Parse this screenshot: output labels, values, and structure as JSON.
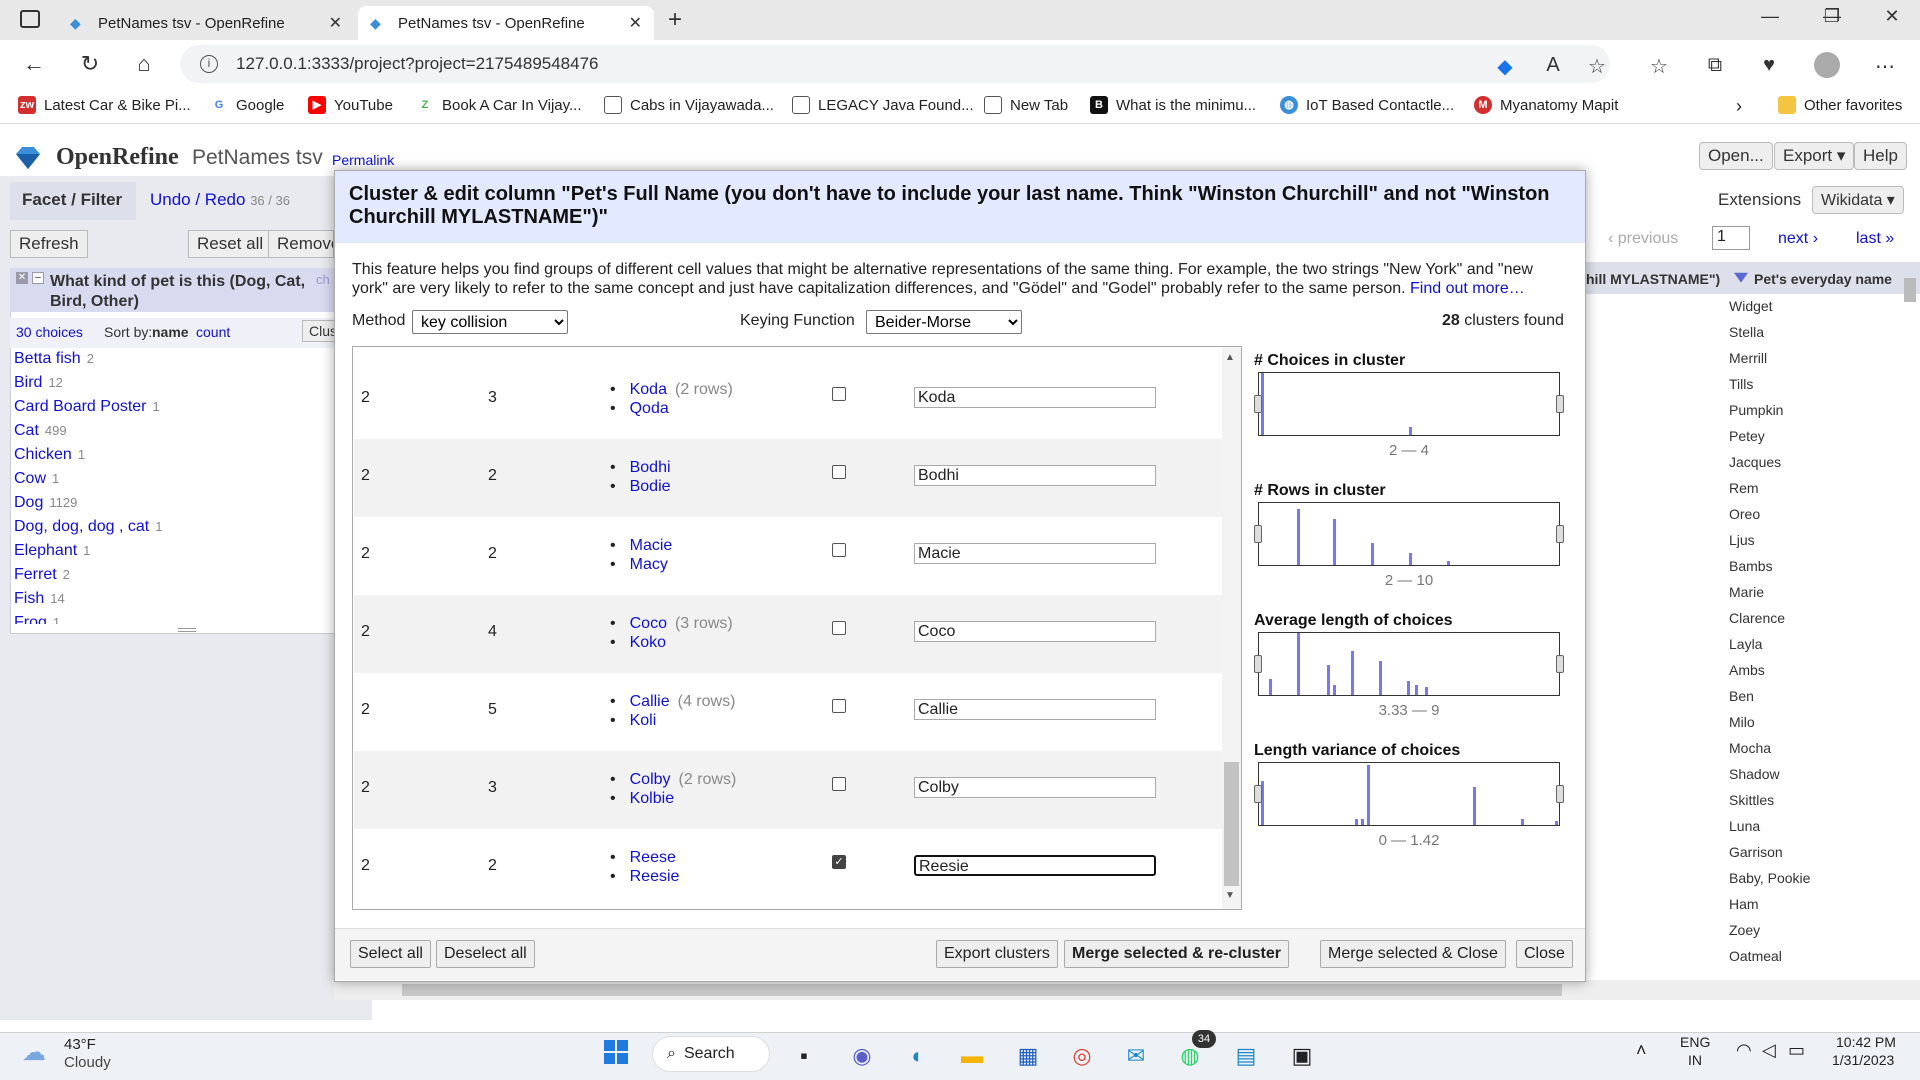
{
  "browser": {
    "tabs": [
      {
        "title": "PetNames tsv - OpenRefine"
      },
      {
        "title": "PetNames tsv - OpenRefine"
      }
    ],
    "url": "127.0.0.1:3333/project?project=2175489548476",
    "bookmarks": [
      {
        "label": "Latest Car & Bike Pi...",
        "icon": "zw-icon",
        "color": "#d32f2f"
      },
      {
        "label": "Google",
        "icon": "google-icon",
        "color": "#4285f4"
      },
      {
        "label": "YouTube",
        "icon": "youtube-icon",
        "color": "#ff0000"
      },
      {
        "label": "Book A Car In Vijay...",
        "icon": "zoomcar-icon",
        "color": "#4caf50"
      },
      {
        "label": "Cabs in Vijayawada...",
        "icon": "page-icon",
        "color": "#888888"
      },
      {
        "label": "LEGACY Java Found...",
        "icon": "page-icon",
        "color": "#888888"
      },
      {
        "label": "New Tab",
        "icon": "page-icon",
        "color": "#888888"
      },
      {
        "label": "What is the minimu...",
        "icon": "b-icon",
        "color": "#111111"
      },
      {
        "label": "IoT Based Contactle...",
        "icon": "globe-icon",
        "color": "#3b8fd9"
      },
      {
        "label": "Myanatomy Mapit",
        "icon": "ma-icon",
        "color": "#d32f2f"
      }
    ],
    "other_favorites": "Other favorites"
  },
  "openrefine": {
    "app_name": "OpenRefine",
    "project_name": "PetNames tsv",
    "permalink": "Permalink",
    "header_buttons": [
      "Open...",
      "Export ▾",
      "Help"
    ],
    "extensions_label": "Extensions",
    "wikidata_button": "Wikidata ▾",
    "tab_facet": "Facet / Filter",
    "tab_undo": "Undo / Redo",
    "undo_count": "36 / 36",
    "refresh": "Refresh",
    "reset_all": "Reset all",
    "remove": "Remove",
    "facet": {
      "title": "What kind of pet is this (Dog, Cat, Bird, Other)",
      "change": "ch",
      "choices": "30 choices",
      "sort_by": "Sort by:",
      "sort_name": "name",
      "sort_count": "count",
      "cluster": "Clus",
      "items": [
        {
          "name": "Betta fish",
          "count": "2"
        },
        {
          "name": "Bird",
          "count": "12"
        },
        {
          "name": "Card Board Poster",
          "count": "1"
        },
        {
          "name": "Cat",
          "count": "499"
        },
        {
          "name": "Chicken",
          "count": "1"
        },
        {
          "name": "Cow",
          "count": "1"
        },
        {
          "name": "Dog",
          "count": "1129"
        },
        {
          "name": "Dog, dog, dog , cat",
          "count": "1"
        },
        {
          "name": "Elephant",
          "count": "1"
        },
        {
          "name": "Ferret",
          "count": "2"
        },
        {
          "name": "Fish",
          "count": "14"
        },
        {
          "name": "Frog",
          "count": "1"
        }
      ]
    },
    "grid": {
      "prev": "‹ previous",
      "page": "1",
      "next": "next ›",
      "last": "last »",
      "col_partial": "hill MYLASTNAME\")",
      "col_header": "Pet's everyday name",
      "rows": [
        "Widget",
        "Stella",
        "Merrill",
        "Tills",
        "Pumpkin",
        "Petey",
        "Jacques",
        "Rem",
        "Oreo",
        "Ljus",
        "Bambs",
        "Marie",
        "Clarence",
        "Layla",
        "Ambs",
        "Ben",
        "Milo",
        "Mocha",
        "Shadow",
        "Skittles",
        "Luna",
        "Garrison",
        "Baby, Pookie",
        "Ham",
        "Zoey",
        "Oatmeal"
      ]
    }
  },
  "dialog": {
    "title": "Cluster & edit column \"Pet's Full Name (you don't have to include your last name. Think \"Winston Churchill\" and not \"Winston Churchill MYLASTNAME\")\"",
    "description": "This feature helps you find groups of different cell values that might be alternative representations of the same thing. For example, the two strings \"New York\" and \"new york\" are very likely to refer to the same concept and just have capitalization differences, and \"Gödel\" and \"Godel\" probably refer to the same person.",
    "find_out_more": "Find out more…",
    "method_label": "Method",
    "method_value": "key collision",
    "keying_label": "Keying Function",
    "keying_value": "Beider-Morse",
    "clusters_count": "28",
    "clusters_found": "clusters found",
    "clusters": [
      {
        "size": "2",
        "rows": "3",
        "values": [
          {
            "v": "Koda",
            "rows": "(2 rows)"
          },
          {
            "v": "Qoda",
            "rows": ""
          }
        ],
        "checked": false,
        "new_value": "Koda"
      },
      {
        "size": "2",
        "rows": "2",
        "values": [
          {
            "v": "Bodhi",
            "rows": ""
          },
          {
            "v": "Bodie",
            "rows": ""
          }
        ],
        "checked": false,
        "new_value": "Bodhi"
      },
      {
        "size": "2",
        "rows": "2",
        "values": [
          {
            "v": "Macie",
            "rows": ""
          },
          {
            "v": "Macy",
            "rows": ""
          }
        ],
        "checked": false,
        "new_value": "Macie"
      },
      {
        "size": "2",
        "rows": "4",
        "values": [
          {
            "v": "Coco",
            "rows": "(3 rows)"
          },
          {
            "v": "Koko",
            "rows": ""
          }
        ],
        "checked": false,
        "new_value": "Coco"
      },
      {
        "size": "2",
        "rows": "5",
        "values": [
          {
            "v": "Callie",
            "rows": "(4 rows)"
          },
          {
            "v": "Koli",
            "rows": ""
          }
        ],
        "checked": false,
        "new_value": "Callie"
      },
      {
        "size": "2",
        "rows": "3",
        "values": [
          {
            "v": "Colby",
            "rows": "(2 rows)"
          },
          {
            "v": "Kolbie",
            "rows": ""
          }
        ],
        "checked": false,
        "new_value": "Colby"
      },
      {
        "size": "2",
        "rows": "2",
        "values": [
          {
            "v": "Reese",
            "rows": ""
          },
          {
            "v": "Reesie",
            "rows": ""
          }
        ],
        "checked": true,
        "new_value": "Reesie"
      }
    ],
    "histograms": [
      {
        "title": "# Choices in cluster",
        "range": "2 — 4"
      },
      {
        "title": "# Rows in cluster",
        "range": "2 — 10"
      },
      {
        "title": "Average length of choices",
        "range": "3.33 — 9"
      },
      {
        "title": "Length variance of choices",
        "range": "0 — 1.42"
      }
    ],
    "buttons": {
      "select_all": "Select all",
      "deselect_all": "Deselect all",
      "export": "Export clusters",
      "merge_recluster": "Merge selected & re-cluster",
      "merge_close": "Merge selected & Close",
      "close": "Close"
    }
  },
  "taskbar": {
    "temperature": "43°F",
    "weather": "Cloudy",
    "search": "Search",
    "whatsapp_badge": "34",
    "lang": "ENG",
    "region": "IN",
    "time": "10:42 PM",
    "date": "1/31/2023"
  }
}
